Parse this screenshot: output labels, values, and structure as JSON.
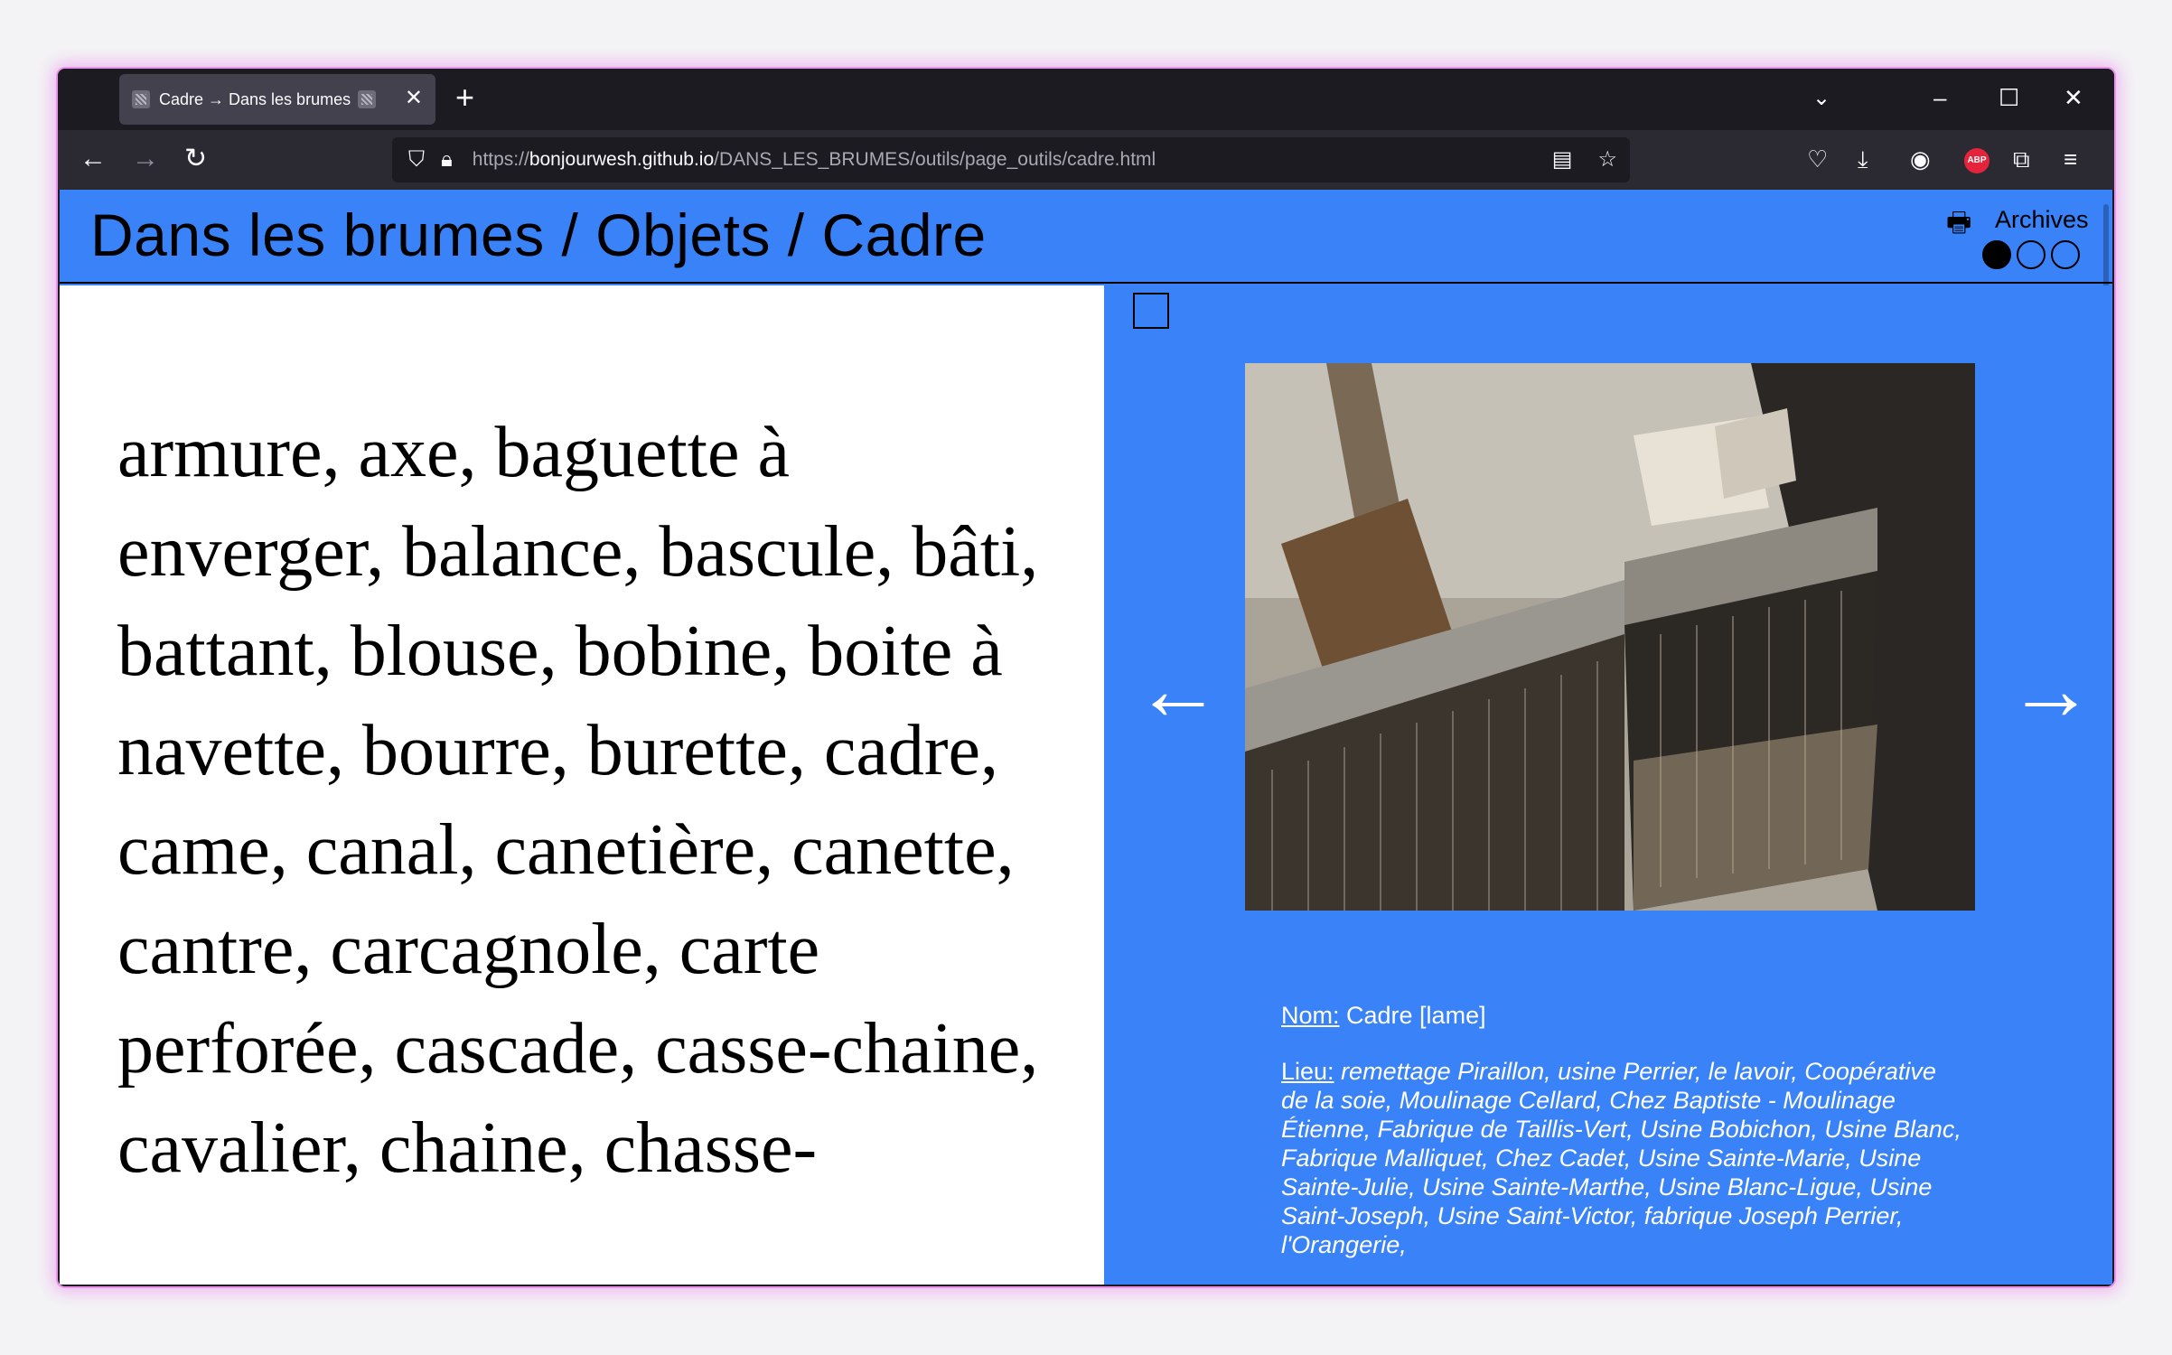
{
  "browser": {
    "tab": {
      "title": "Cadre → Dans les brumes"
    },
    "url": {
      "scheme": "https://",
      "host": "bonjourwesh.github.io",
      "path": "/DANS_LES_BRUMES/outils/page_outils/cadre.html"
    }
  },
  "header": {
    "title": "Dans les brumes / Objets / Cadre",
    "archives_label": "Archives"
  },
  "left_panel": {
    "words": "armure, axe, baguette à enverger, balance, bascule, bâti, battant, blouse, bobine, boite à navette, bourre, burette, cadre, came, canal, canetière, canette, cantre, carcagnole, carte perforée, cascade, casse-chaine, cavalier, chaine, chasse-"
  },
  "right_panel": {
    "photo_alt": "Cadre de métier à tisser",
    "prev_arrow": "←",
    "next_arrow": "→",
    "nom_label": "Nom:",
    "nom_value": " Cadre [lame]",
    "lieu_label": "Lieu:",
    "lieu_value": " remettage Piraillon, usine Perrier, le lavoir, Coopérative de la soie, Moulinage Cellard, Chez Baptiste - Moulinage Étienne, Fabrique de Taillis-Vert, Usine Bobichon, Usine Blanc, Fabrique Malliquet, Chez Cadet, Usine Sainte-Marie, Usine Sainte-Julie, Usine Sainte-Marthe, Usine Blanc-Ligue, Usine Saint-Joseph, Usine Saint-Victor, fabrique Joseph Perrier, l'Orangerie,"
  },
  "colors": {
    "accent": "#3a82f7",
    "browser_dark": "#1c1b22"
  }
}
